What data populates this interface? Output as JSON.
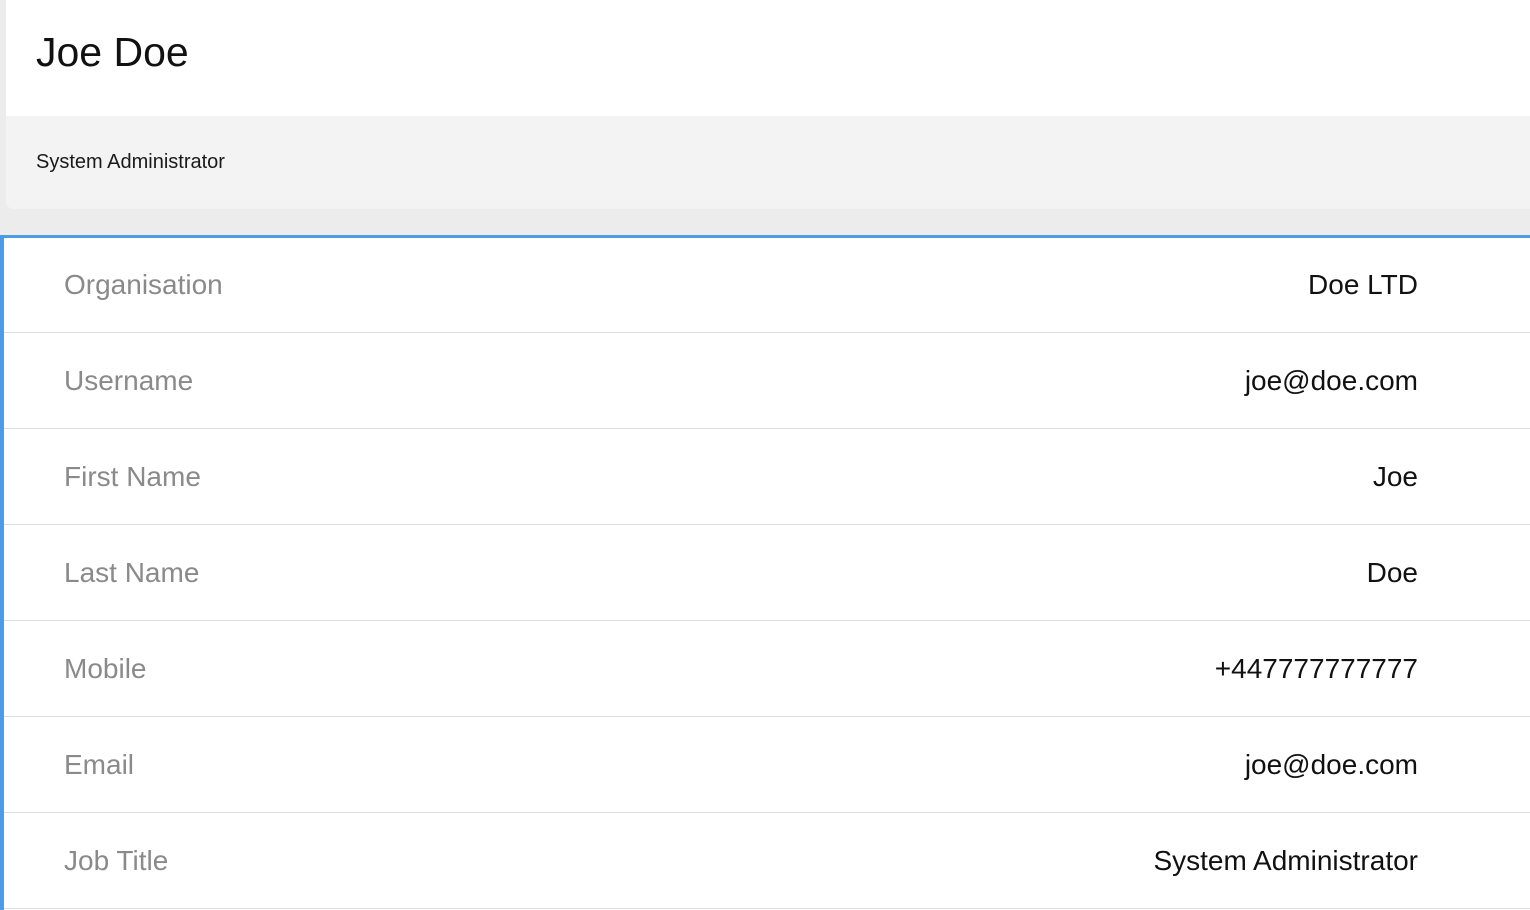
{
  "header": {
    "name": "Joe Doe",
    "role": "System Administrator"
  },
  "details": {
    "rows": [
      {
        "label": "Organisation",
        "value": "Doe LTD"
      },
      {
        "label": "Username",
        "value": "joe@doe.com"
      },
      {
        "label": "First Name",
        "value": "Joe"
      },
      {
        "label": "Last Name",
        "value": "Doe"
      },
      {
        "label": "Mobile",
        "value": "+447777777777"
      },
      {
        "label": "Email",
        "value": "joe@doe.com"
      },
      {
        "label": "Job Title",
        "value": "System Administrator"
      }
    ]
  },
  "colors": {
    "accent": "#4a9be8",
    "label": "#8a8a8a",
    "value": "#111111",
    "header_sub_bg": "#f3f3f3"
  }
}
